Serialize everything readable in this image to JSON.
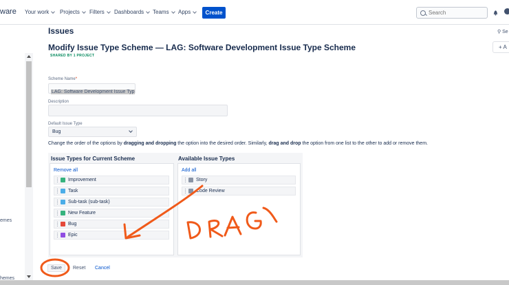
{
  "nav": {
    "logo": "ware",
    "items": [
      "Your work",
      "Projects",
      "Filters",
      "Dashboards",
      "Teams",
      "Apps"
    ],
    "create_label": "Create",
    "search_placeholder": "Search"
  },
  "sidebar": {
    "label1": "emes",
    "label2": "hemes"
  },
  "page": {
    "section": "Issues",
    "heading": "Modify Issue Type Scheme — LAG: Software Development Issue Type Scheme",
    "shared": "SHARED BY 1 PROJECT",
    "right_search": "Se",
    "right_add": "+ A"
  },
  "form": {
    "scheme_label": "Scheme Name",
    "scheme_value": "LAG: Software Development Issue Typ",
    "description_label": "Description",
    "default_label": "Default Issue Type",
    "default_value": "Bug",
    "instructions": {
      "p1": "Change the order of the options by ",
      "b1": "dragging and dropping",
      "p2": " the option into the desired order. Similarly, ",
      "b2": "drag and drop",
      "p3": " the option from one list to the other to add or remove them."
    }
  },
  "current_list": {
    "title": "Issue Types for Current Scheme",
    "action": "Remove all",
    "items": [
      {
        "label": "Improvement",
        "color": "#36b37e"
      },
      {
        "label": "Task",
        "color": "#4bade8"
      },
      {
        "label": "Sub-task (sub-task)",
        "color": "#4bade8"
      },
      {
        "label": "New Feature",
        "color": "#36b37e"
      },
      {
        "label": "Bug",
        "color": "#e5493a"
      },
      {
        "label": "Epic",
        "color": "#904ee2"
      }
    ]
  },
  "available_list": {
    "title": "Available Issue Types",
    "action": "Add all",
    "items": [
      {
        "label": "Story",
        "color": "#8993a4"
      },
      {
        "label": "Code Review",
        "color": "#8993a4"
      }
    ]
  },
  "buttons": {
    "save": "Save",
    "reset": "Reset",
    "cancel": "Cancel"
  },
  "annotation": {
    "text": "DRAG",
    "color": "#f05a1a"
  }
}
